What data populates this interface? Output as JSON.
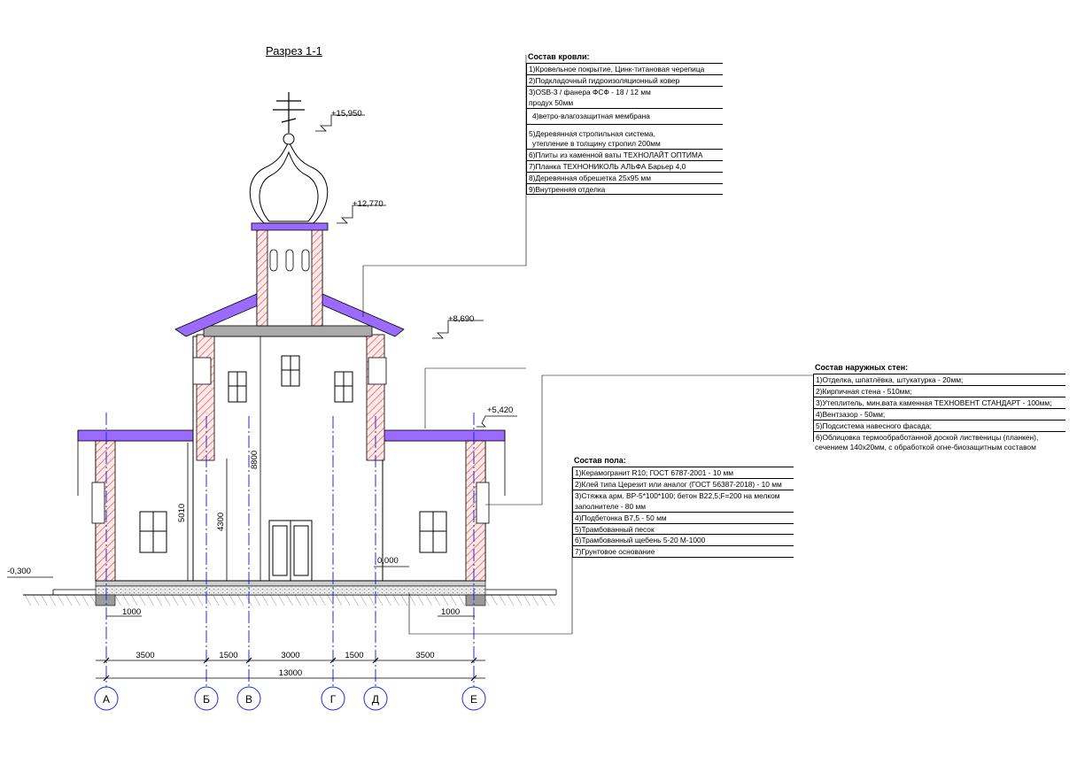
{
  "title": "Разрез 1-1",
  "roof": {
    "header": "Состав кровли:",
    "rows": [
      "1)Кровельное покрытие, Цинк-титановая черепица",
      "2)Подкладочный гидроизоляционный ковер",
      "3)OSB-3 / фанера ФСФ - 18 / 12 мм",
      "продух 50мм",
      "4)ветро-влагозащитная мембрана",
      "5)Деревянная стропильная система,",
      "утепление в толщину стропил 200мм",
      "6)Плиты из каменной ваты ТЕХНОЛАЙТ ОПТИМА",
      "7)Планка ТЕХНОНИКОЛЬ АЛЬФА Барьер 4,0",
      "8)Деревянная обрешетка 25х95 мм",
      "9)Внутренняя отделка"
    ]
  },
  "walls": {
    "header": "Состав наружных стен:",
    "rows": [
      "1)Отделка, шпатлёвка, штукатурка - 20мм;",
      "2)Кирпичная стена - 510мм;",
      "3)Утеплитель, мин.вата каменная ТЕХНОВЕНТ СТАНДАРТ - 100мм;",
      "4)Вентзазор - 50мм;",
      "5)Подсистема навесного фасада;",
      "6)Облицовка термообработанной доской лиственицы (планкен),",
      "сечением 140х20мм, с обработкой огне-биозащитным составом"
    ]
  },
  "floor": {
    "header": "Состав пола:",
    "rows": [
      "1)Керамогранит R10; ГОСТ 6787-2001 - 10 мм",
      "2)Клей типа Церезит  или аналог (ГОСТ 56387-2018) - 10 мм",
      "3)Стяжка арм. ВР-5*100*100; бетон В22,5;F=200 на мелком",
      "заполнителе - 80 мм",
      "4)Подбетонка В7,5 - 50 мм",
      "5)Трамбованный песок",
      "6)Трамбованный щебень 5-20 М-1000",
      "7)Грунтовое основание"
    ]
  },
  "levels": [
    "+15,950",
    "+12,770",
    "+8,690",
    "+5,420",
    "0,000",
    "-0,300"
  ],
  "vertical_dims": [
    "5010",
    "4300",
    "8800"
  ],
  "offsets": [
    "1000",
    "1000"
  ],
  "bottom_dims": [
    "3500",
    "1500",
    "3000",
    "1500",
    "3500"
  ],
  "total_dim": "13000",
  "axes": [
    "А",
    "Б",
    "В",
    "Г",
    "Д",
    "Е"
  ],
  "colors": {
    "line": "#000000",
    "roof_insulation": "#7b2cf0",
    "brick_hatch": "#e05050",
    "axis": "#1f2ad8",
    "ground": "#d9d9d9"
  }
}
